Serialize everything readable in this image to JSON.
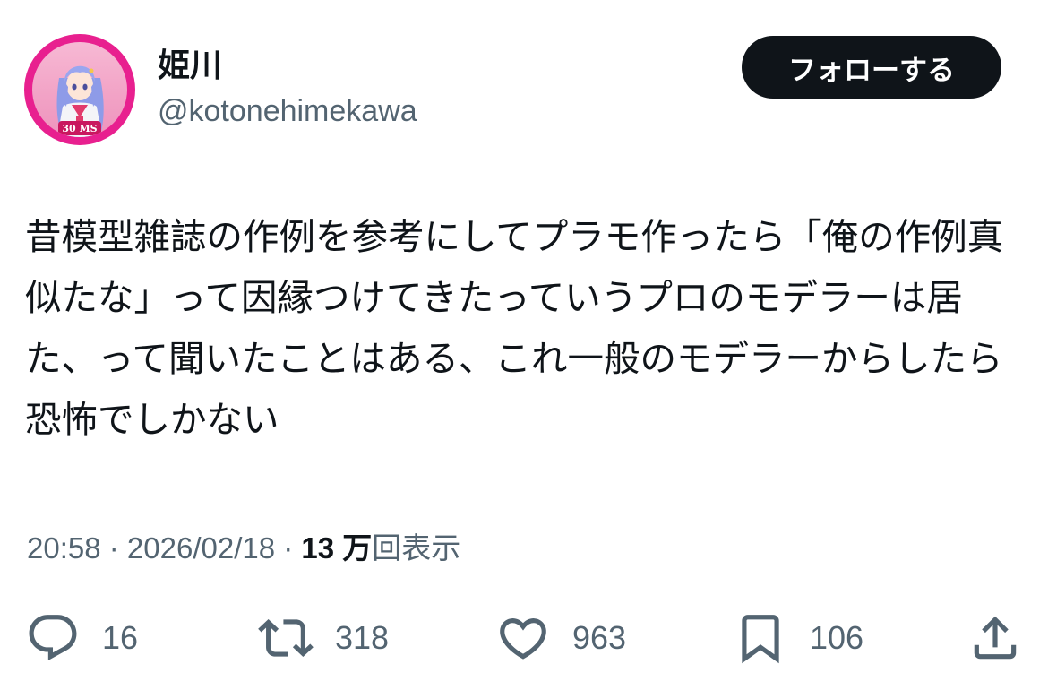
{
  "author": {
    "display_name": "姫川",
    "handle": "@kotonehimekawa",
    "avatar_badge": "30 MS"
  },
  "follow_button": {
    "label": "フォローする"
  },
  "tweet": {
    "text": "昔模型雑誌の作例を参考にしてプラモ作ったら「俺の作例真似たな」って因縁つけてきたっていうプロのモデラーは居た、って聞いたことはある、これ一般のモデラーからしたら恐怖でしかない"
  },
  "meta": {
    "time": "20:58",
    "sep1": " · ",
    "date": "2026/02/18",
    "sep2": " · ",
    "views_count": "13 万",
    "views_label": "回表示"
  },
  "actions": {
    "replies": "16",
    "retweets": "318",
    "likes": "963",
    "bookmarks": "106"
  },
  "icons": [
    "reply-icon",
    "retweet-icon",
    "like-icon",
    "bookmark-icon",
    "share-icon"
  ],
  "colors": {
    "text_primary": "#0f1419",
    "text_secondary": "#536471",
    "follow_bg": "#0f1419",
    "avatar_ring": "#e8208f"
  }
}
